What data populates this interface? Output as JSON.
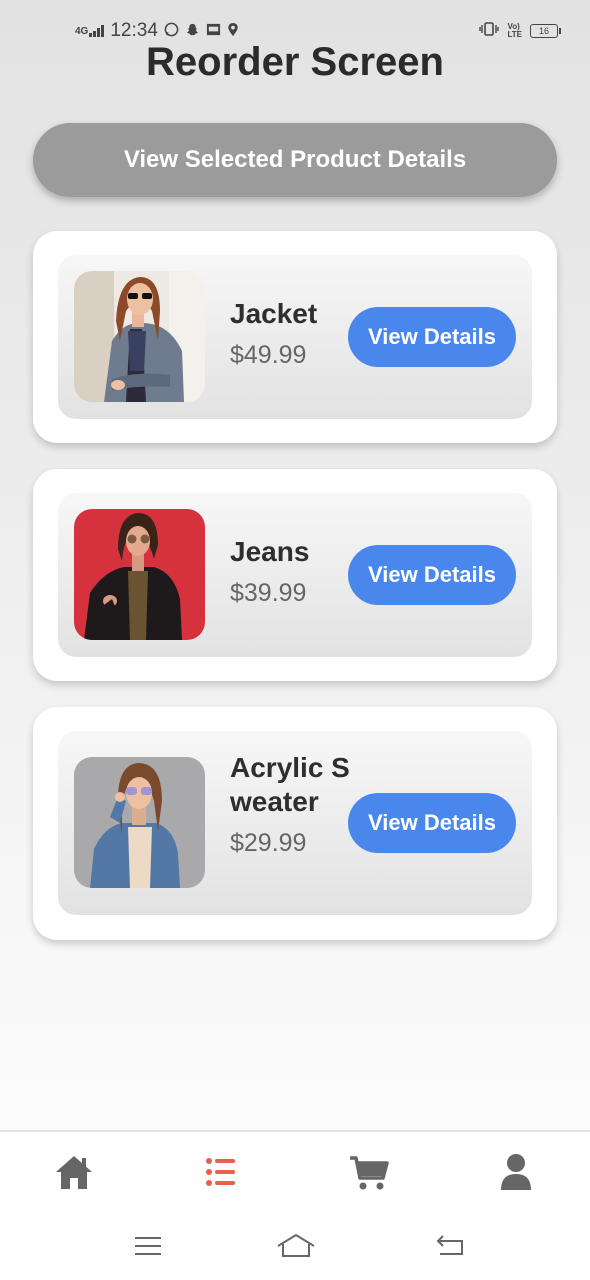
{
  "status_bar": {
    "network": "4G",
    "time": "12:34",
    "volte": "Vo)\nLTE",
    "battery": "16"
  },
  "header": {
    "title": "Reorder Screen"
  },
  "top_button": {
    "label": "View Selected Product Details"
  },
  "products": [
    {
      "name": "Jacket",
      "price": "$49.99",
      "button_label": "View Details",
      "image": "woman-in-grey-blazer-photo"
    },
    {
      "name": "Jeans",
      "price": "$39.99",
      "button_label": "View Details",
      "image": "woman-in-leather-jacket-photo"
    },
    {
      "name": "Acrylic Sweater",
      "price": "$29.99",
      "button_label": "View Details",
      "image": "woman-in-denim-jacket-photo"
    }
  ],
  "bottom_nav": {
    "items": [
      {
        "icon": "home-icon",
        "active": false
      },
      {
        "icon": "list-icon",
        "active": true
      },
      {
        "icon": "cart-icon",
        "active": false
      },
      {
        "icon": "user-icon",
        "active": false
      }
    ],
    "active_color": "#e8604a",
    "inactive_color": "#666666"
  },
  "colors": {
    "accent": "#4a87ec",
    "top_button": "#9b9b9b"
  }
}
